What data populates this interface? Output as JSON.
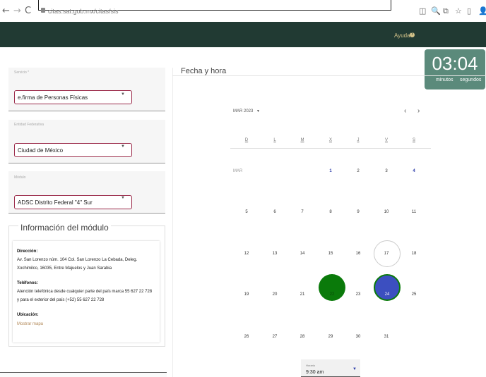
{
  "browser": {
    "back": "←",
    "forward": "→",
    "reload": "C",
    "url": "citas.sat.gob.mx/citas/sis",
    "toolbar_icons": [
      "◫",
      "🔍",
      "⧉",
      "☆",
      "▯",
      "👤"
    ]
  },
  "header": {
    "help_label": "Ayuda",
    "help_icon": "?"
  },
  "timer": {
    "time": "03:04",
    "minutes_label": "minutos",
    "seconds_label": "segundos"
  },
  "form": {
    "service": {
      "label": "Servicio *",
      "value": "e.firma de Personas Físicas"
    },
    "state": {
      "label": "Entidad Federativa",
      "value": "Ciudad de México"
    },
    "module": {
      "label": "Módulo",
      "value": "ADSC Distrito Federal \"4\" Sur"
    },
    "caret": "▼"
  },
  "module_info": {
    "title": "Información del módulo",
    "address_label": "Dirección:",
    "address_line1": "Av. San Lorenzo núm. 104 Col. San Lorenzo La Cebada, Deleg.",
    "address_line2": "Xochimilco, 16035, Entre Majuelos y Juan Sarabia",
    "phone_label": "Teléfonos:",
    "phone_line1": "Atención telefónica desde cualquier parte del país marca 55 627 22 728",
    "phone_line2": "y para el exterior del país (+52) 55 627 22 728",
    "location_label": "Ubicación:",
    "map_link": "Mostrar mapa"
  },
  "calendar": {
    "title": "Fecha y hora",
    "month_label": "MAR 2023",
    "month_caret": "▼",
    "prev": "‹",
    "next": "›",
    "weekdays": [
      "D",
      "L",
      "M",
      "X",
      "J",
      "V",
      "S"
    ],
    "month_short": "MAR",
    "weeks": [
      [
        "",
        "",
        "",
        "1",
        "2",
        "3",
        "4"
      ],
      [
        "5",
        "6",
        "7",
        "8",
        "9",
        "10",
        "11"
      ],
      [
        "12",
        "13",
        "14",
        "15",
        "16",
        "17",
        "18"
      ],
      [
        "19",
        "20",
        "21",
        "22",
        "23",
        "24",
        "25"
      ],
      [
        "26",
        "27",
        "28",
        "29",
        "30",
        "31",
        ""
      ]
    ]
  },
  "hour": {
    "label": "Horario",
    "value": "9:30 am",
    "caret": "▼"
  }
}
